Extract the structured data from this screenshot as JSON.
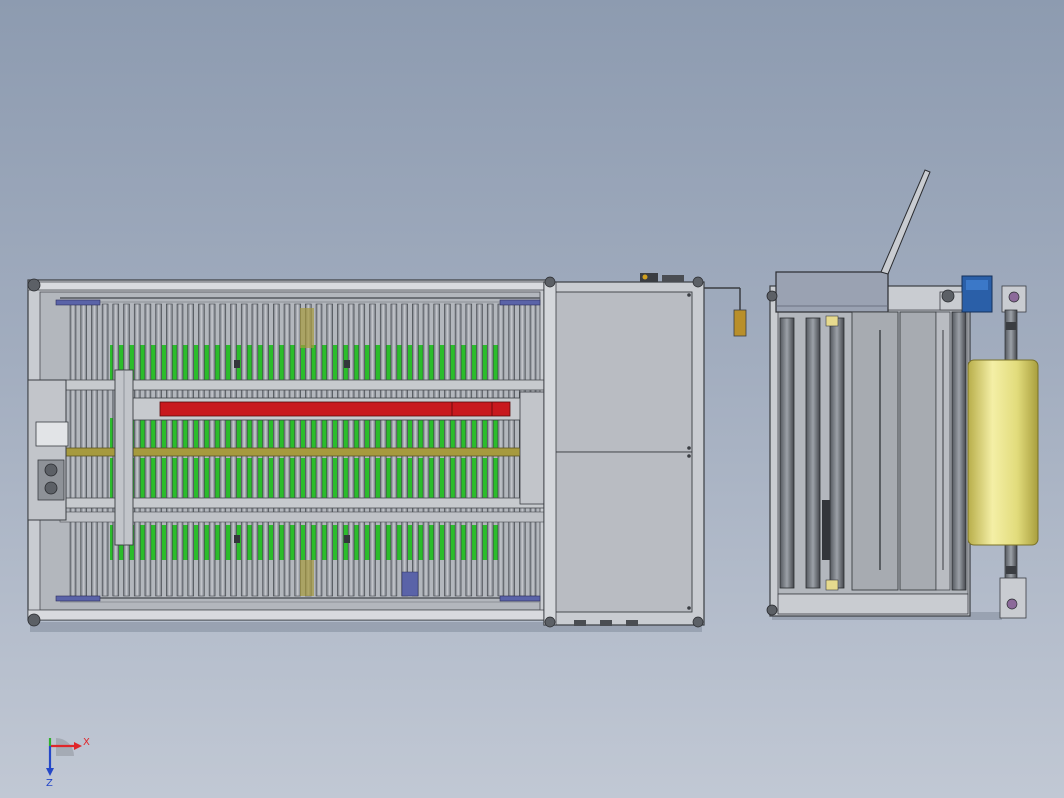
{
  "view": {
    "background_top": "#8d9bb0",
    "background_bottom": "#c1c8d4"
  },
  "machine_left": {
    "frame_color": "#c4c7cc",
    "roller_color": "#9aa0a8",
    "belt_color": "#2bbd2b",
    "heater_color": "#c8191e",
    "guide_color": "#9b8f3c",
    "cabinet_color": "#b9bcc2",
    "roller_count": 44
  },
  "machine_right": {
    "hood_color": "#9aa2b2",
    "motor_color": "#2a5fa8",
    "film_roll_color": "#e2dc7c",
    "panel_color": "#a7abb1"
  },
  "triad": {
    "x_label": "X",
    "z_label": "Z",
    "x_color": "#e0262a",
    "y_color": "#30b030",
    "z_color": "#2447c8"
  }
}
